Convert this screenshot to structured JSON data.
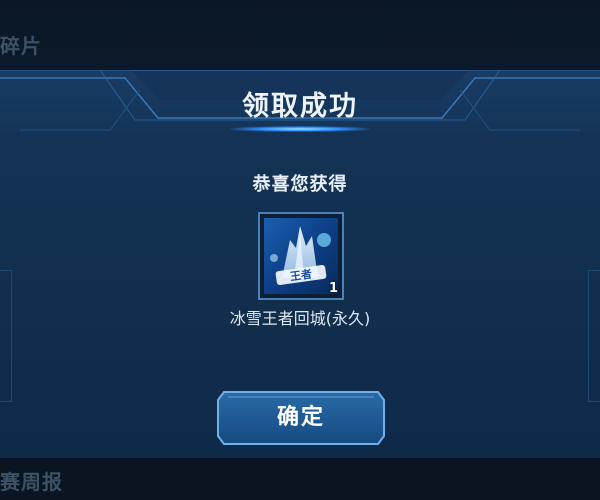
{
  "background": {
    "top_label": "碎片",
    "bottom_label": "赛周报"
  },
  "dialog": {
    "title": "领取成功",
    "subtitle": "恭喜您获得",
    "item": {
      "name": "冰雪王者回城(永久)",
      "count": "1",
      "icon": "snow-king-recall-icon"
    },
    "confirm_label": "确定"
  },
  "colors": {
    "dialog_bg": "#133253",
    "accent_glow": "#2f8fff",
    "frame": "#4d82b8"
  }
}
